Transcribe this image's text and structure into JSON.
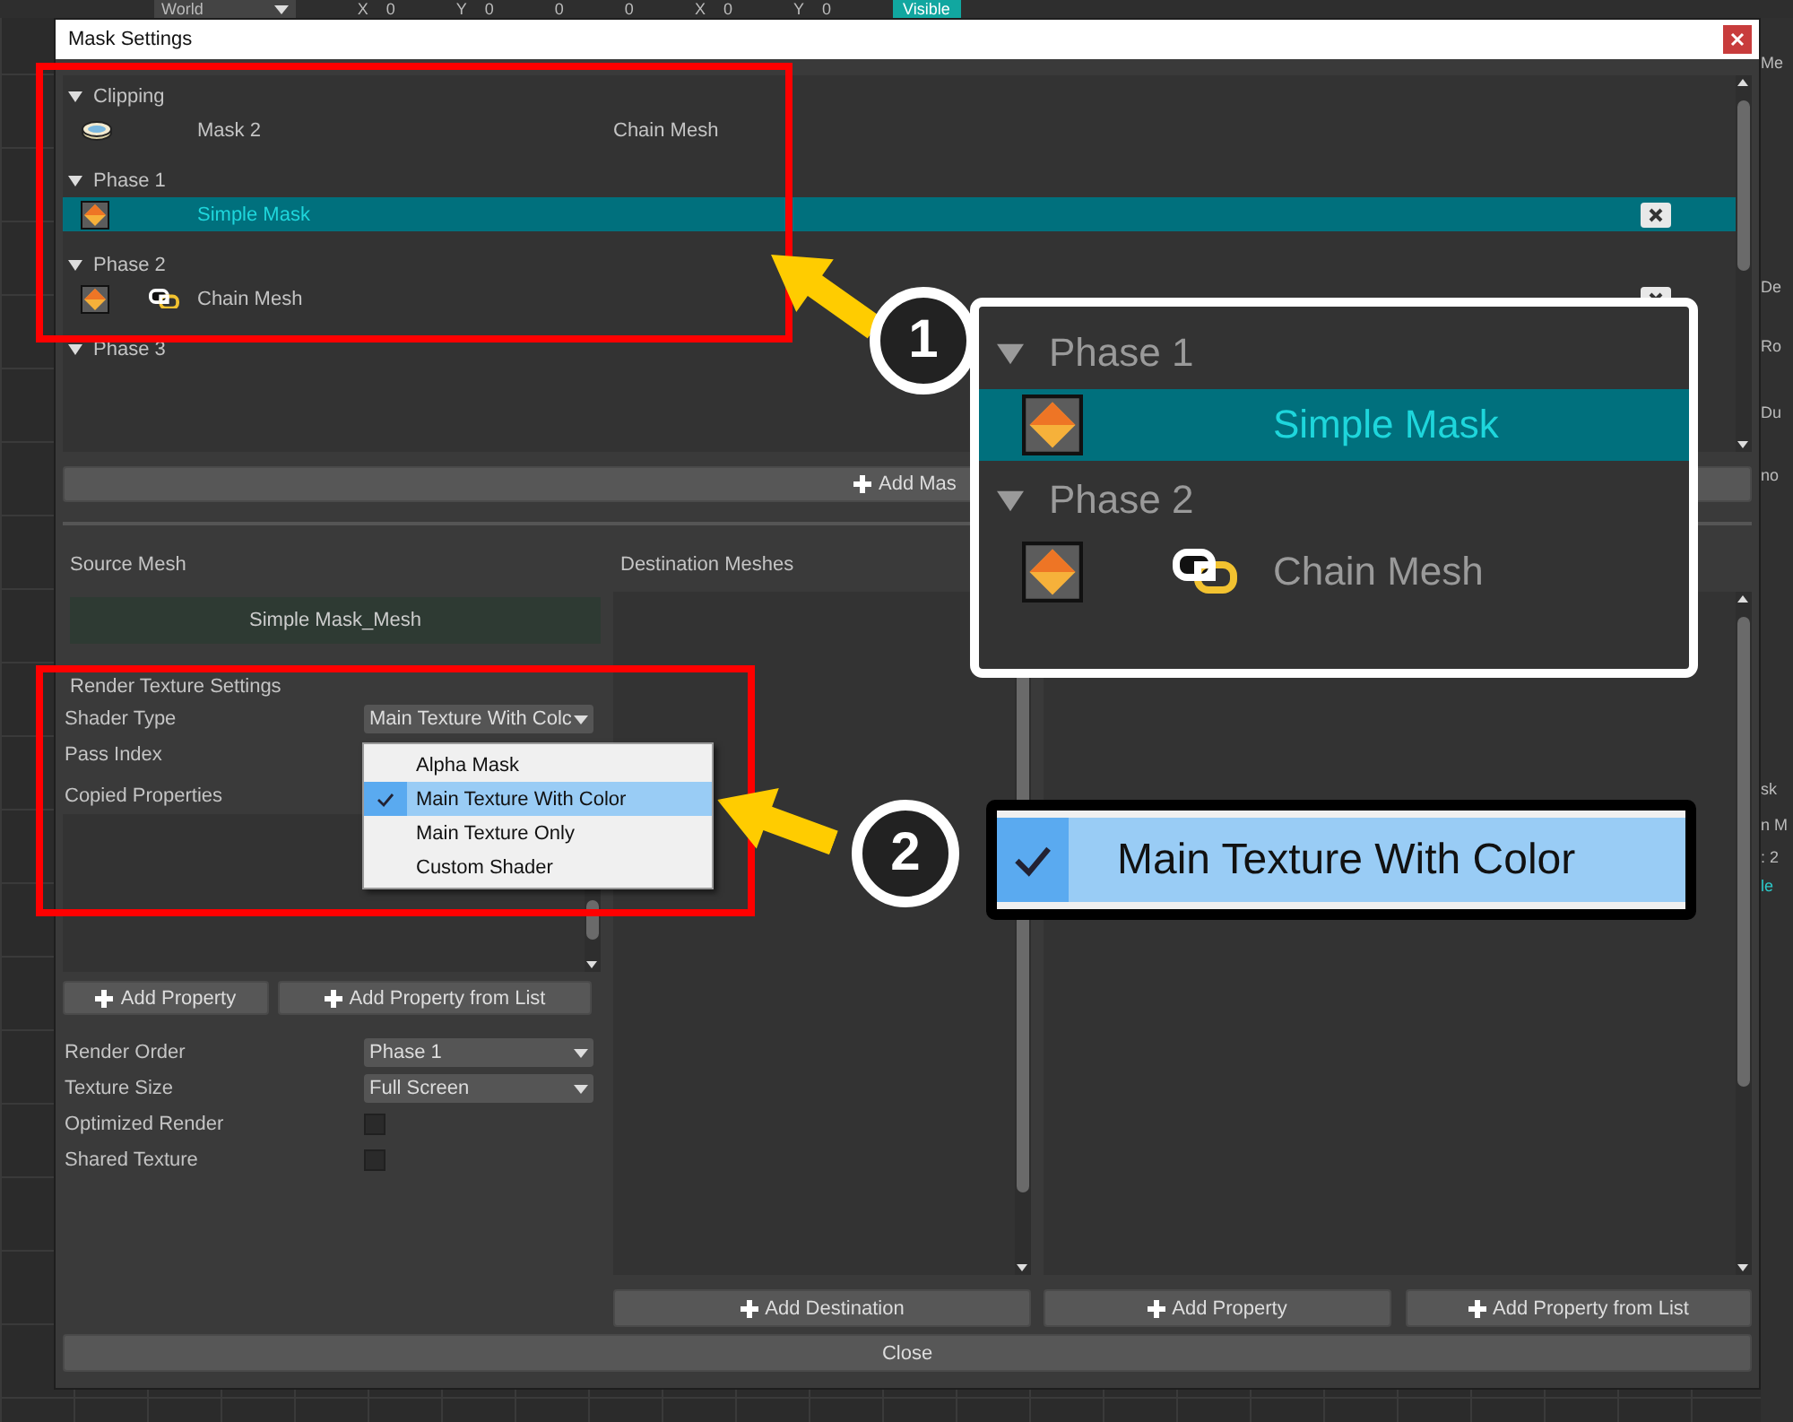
{
  "toolbar": {
    "items": [
      {
        "kind": "dropdown",
        "label": "World"
      },
      {
        "kind": "field",
        "label": "X",
        "value": "0"
      },
      {
        "kind": "field",
        "label": "Y",
        "value": "0"
      },
      {
        "kind": "field",
        "value": "0"
      },
      {
        "kind": "field",
        "value": "0"
      },
      {
        "kind": "field",
        "label": "X",
        "value": "0"
      },
      {
        "kind": "field",
        "label": "Y",
        "value": "0"
      },
      {
        "kind": "toggle",
        "label": "Visible",
        "on": true
      }
    ]
  },
  "side_panel": {
    "fragments": [
      "Me",
      "De",
      "Ro",
      "Du",
      "no",
      "sk",
      "n M",
      ": 2",
      "le"
    ]
  },
  "dialog": {
    "title": "Mask Settings"
  },
  "mask_list": {
    "groups": [
      {
        "label": "Clipping",
        "expanded": true,
        "items": [
          {
            "kind": "clip",
            "name": "Mask 2",
            "target": "Chain Mesh",
            "linked": false,
            "selected": false,
            "removable": false
          }
        ]
      },
      {
        "label": "Phase 1",
        "expanded": true,
        "items": [
          {
            "kind": "mask",
            "name": "Simple Mask",
            "linked": false,
            "selected": true,
            "removable": true
          }
        ]
      },
      {
        "label": "Phase 2",
        "expanded": true,
        "items": [
          {
            "kind": "mask",
            "name": "Chain Mesh",
            "linked": true,
            "selected": false,
            "removable": true
          }
        ]
      },
      {
        "label": "Phase 3",
        "expanded": true
      }
    ]
  },
  "add_mask_button": "Add Mas",
  "source_mesh": {
    "heading": "Source Mesh",
    "value": "Simple Mask_Mesh"
  },
  "render_texture_settings": {
    "heading": "Render Texture Settings",
    "shader_type": {
      "label": "Shader Type",
      "value": "Main Texture With Colc"
    },
    "pass_index": {
      "label": "Pass Index"
    },
    "copied_properties": {
      "label": "Copied Properties"
    },
    "buttons": [
      "Add Property",
      "Add Property from List"
    ],
    "render_order": {
      "label": "Render Order",
      "value": "Phase 1"
    },
    "texture_size": {
      "label": "Texture Size",
      "value": "Full Screen"
    },
    "options": [
      {
        "label": "Optimized Render",
        "checked": false
      },
      {
        "label": "Shared Texture",
        "checked": false
      }
    ]
  },
  "shader_menu": {
    "options": [
      {
        "label": "Alpha Mask",
        "selected": false
      },
      {
        "label": "Main Texture With Color",
        "selected": true
      },
      {
        "label": "Main Texture Only",
        "selected": false
      },
      {
        "label": "Custom Shader",
        "selected": false
      }
    ]
  },
  "destination_meshes": {
    "heading": "Destination Meshes",
    "button": "Add Destination"
  },
  "properties": {
    "buttons": [
      "Add Property",
      "Add Property from List"
    ]
  },
  "close_button": "Close",
  "callouts": [
    {
      "number": "1"
    },
    {
      "number": "2"
    }
  ],
  "zoom_insets": [
    {
      "kind": "tree",
      "groups": [
        {
          "label": "Phase 1",
          "expanded": true,
          "items": [
            {
              "name": "Simple Mask",
              "linked": false,
              "selected": true
            }
          ]
        },
        {
          "label": "Phase 2",
          "expanded": true,
          "items": [
            {
              "name": "Chain Mesh",
              "linked": true,
              "selected": false
            }
          ]
        }
      ]
    },
    {
      "kind": "menu",
      "option": {
        "label": "Main Texture With Color",
        "selected": true
      }
    }
  ]
}
